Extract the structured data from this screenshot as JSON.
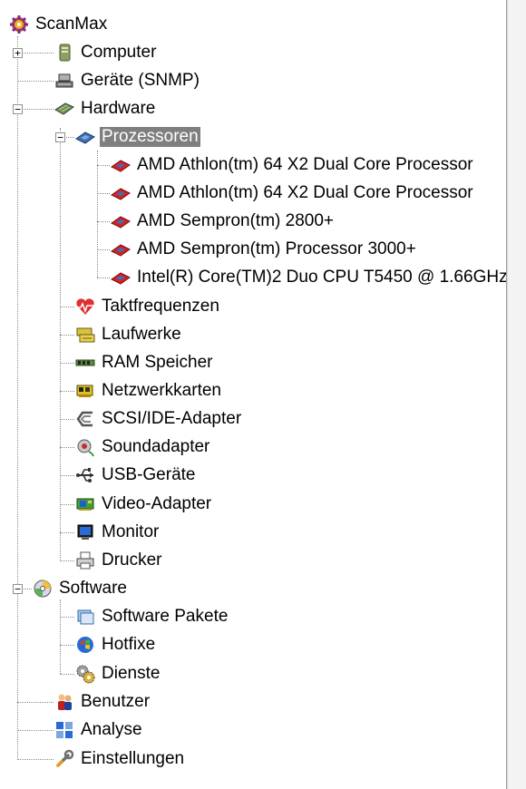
{
  "tree": {
    "root": {
      "label": "ScanMax",
      "icon": "gear-scan-icon"
    },
    "items": [
      {
        "label": "Computer",
        "icon": "computer-tower-icon",
        "expander": "+"
      },
      {
        "label": "Geräte (SNMP)",
        "icon": "network-device-icon"
      },
      {
        "label": "Hardware",
        "icon": "hardware-board-icon",
        "expander": "−"
      },
      {
        "label": "Prozessoren",
        "icon": "cpu-chip-icon",
        "expander": "−",
        "selected": true
      },
      {
        "label": "AMD Athlon(tm) 64 X2 Dual Core Processor",
        "icon": "cpu-red-icon"
      },
      {
        "label": "AMD Athlon(tm) 64 X2 Dual Core Processor",
        "icon": "cpu-red-icon"
      },
      {
        "label": "AMD Sempron(tm)  2800+",
        "icon": "cpu-red-icon"
      },
      {
        "label": "AMD Sempron(tm) Processor 3000+",
        "icon": "cpu-red-icon"
      },
      {
        "label": "Intel(R) Core(TM)2 Duo CPU     T5450  @ 1.66GHz",
        "icon": "cpu-red-icon"
      },
      {
        "label": "Taktfrequenzen",
        "icon": "heart-pulse-icon"
      },
      {
        "label": "Laufwerke",
        "icon": "drive-icon"
      },
      {
        "label": "RAM Speicher",
        "icon": "ram-module-icon"
      },
      {
        "label": "Netzwerkkarten",
        "icon": "network-card-icon"
      },
      {
        "label": "SCSI/IDE-Adapter",
        "icon": "scsi-adapter-icon"
      },
      {
        "label": "Soundadapter",
        "icon": "speaker-icon"
      },
      {
        "label": "USB-Geräte",
        "icon": "usb-icon"
      },
      {
        "label": "Video-Adapter",
        "icon": "video-card-icon"
      },
      {
        "label": "Monitor",
        "icon": "monitor-icon"
      },
      {
        "label": "Drucker",
        "icon": "printer-icon"
      },
      {
        "label": "Software",
        "icon": "software-disc-icon",
        "expander": "−"
      },
      {
        "label": "Software Pakete",
        "icon": "software-package-icon"
      },
      {
        "label": "Hotfixe",
        "icon": "windows-update-icon"
      },
      {
        "label": "Dienste",
        "icon": "services-gears-icon"
      },
      {
        "label": "Benutzer",
        "icon": "users-icon"
      },
      {
        "label": "Analyse",
        "icon": "analysis-grid-icon"
      },
      {
        "label": "Einstellungen",
        "icon": "wrench-icon"
      }
    ]
  },
  "colors": {
    "selection": "#7f7f7f",
    "cpu_red": "#d42020",
    "cpu_blue": "#3d6fb6"
  }
}
